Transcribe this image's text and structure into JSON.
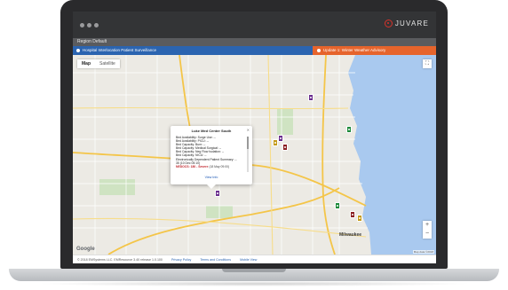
{
  "header": {
    "brand": "JUVARE",
    "region": "Region Default"
  },
  "tabs": {
    "left": "Hospital Interlocation Patient Surveillance",
    "right": "Update 1: Winter Weather Advisory"
  },
  "map": {
    "toggle_map": "Map",
    "toggle_satellite": "Satellite",
    "google": "Google",
    "attribution": "Map data ©2018",
    "city": "Milwaukee",
    "colors": {
      "purple": "#6b2f8f",
      "green": "#1f8a3b",
      "darkred": "#8a1f22",
      "gold": "#c49a1a"
    }
  },
  "info_window": {
    "title": "Luke Med Center South",
    "lines": [
      "Bed Availability: Surge Use: --",
      "Bed Availability: PICU: --",
      "Bed Capacity: Burn: --",
      "Bed Capacity: Medical Surgical: --",
      "Bed Capacity: Neg Flow Isolation: --",
      "Bed Capacity: NICU: --",
      "Electronically Dependent Patient Summary: --",
      "35 (10 Dec 05:10)"
    ],
    "nedocs_label": "NEDOCS: 180 - Severe",
    "nedocs_date": "(18 May 09:00)",
    "view_info": "View Info"
  },
  "footer": {
    "copyright": "© 2018 EMSystems LLC. EMResource 3.40 release 1.0.100",
    "links": [
      "Privacy Policy",
      "Terms and Conditions",
      "Mobile View"
    ]
  }
}
